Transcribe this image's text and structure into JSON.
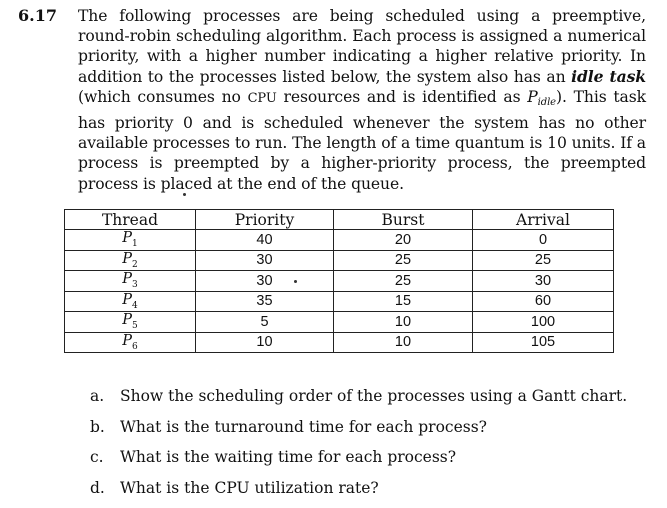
{
  "problem": {
    "number": "6.17",
    "text_1": "The following processes are being scheduled using a preemptive, round-robin scheduling algorithm. Each process is assigned a numerical priority, with a higher number indicating a higher relative priority. In addition to the processes listed below, the system also has an ",
    "idle_term": "idle task",
    "text_2": " (which consumes no ",
    "cpu_acronym": "CPU",
    "text_3": " resources and is identified as ",
    "p_symbol": "P",
    "p_subscript": "idle",
    "text_4": "). This task has priority 0 and is scheduled whenever the system has no other available processes to run. The length of a time quantum is 10 units. If a process is preempted by a higher-priority process, the preempted process is placed at the end of the queue."
  },
  "table": {
    "headers": {
      "thread": "Thread",
      "priority": "Priority",
      "burst": "Burst",
      "arrival": "Arrival"
    },
    "rows": [
      {
        "thread": "P",
        "sub": "1",
        "priority": "40",
        "burst": "20",
        "arrival": "0"
      },
      {
        "thread": "P",
        "sub": "2",
        "priority": "30",
        "burst": "25",
        "arrival": "25"
      },
      {
        "thread": "P",
        "sub": "3",
        "priority": "30",
        "burst": "25",
        "arrival": "30"
      },
      {
        "thread": "P",
        "sub": "4",
        "priority": "35",
        "burst": "15",
        "arrival": "60"
      },
      {
        "thread": "P",
        "sub": "5",
        "priority": "5",
        "burst": "10",
        "arrival": "100"
      },
      {
        "thread": "P",
        "sub": "6",
        "priority": "10",
        "burst": "10",
        "arrival": "105"
      }
    ]
  },
  "questions": [
    {
      "letter": "a.",
      "text": "Show the scheduling order of the processes using a Gantt chart."
    },
    {
      "letter": "b.",
      "text": "What is the turnaround time for each process?"
    },
    {
      "letter": "c.",
      "text": "What is the waiting time for each process?"
    },
    {
      "letter": "d.",
      "text": "What is the CPU utilization rate?"
    }
  ]
}
